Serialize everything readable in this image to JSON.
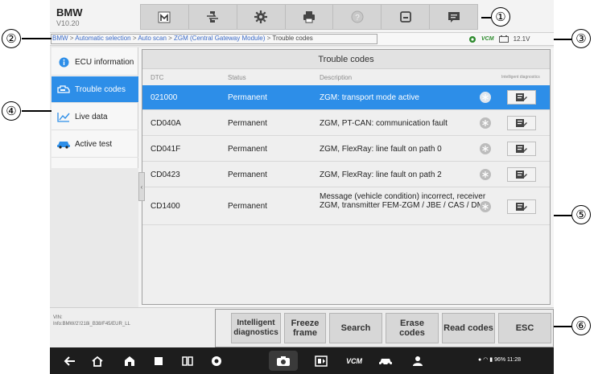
{
  "header": {
    "brand": "BMW",
    "version": "V10.20"
  },
  "toolbar": {
    "icons": [
      "home-icon",
      "vehicle-swap-icon",
      "settings-gear-icon",
      "printer-icon",
      "help-icon",
      "save-icon",
      "message-icon"
    ]
  },
  "breadcrumb": {
    "parts": [
      "BMW",
      "Automatic selection",
      "Auto scan",
      "ZGM (Central Gateway Module)"
    ],
    "current": "Trouble codes",
    "separator": " > "
  },
  "status": {
    "vcm": "VCM",
    "voltage": "12.1V"
  },
  "sidebar": {
    "items": [
      {
        "label": "ECU information",
        "icon": "info-icon"
      },
      {
        "label": "Trouble codes",
        "icon": "engine-fault-icon"
      },
      {
        "label": "Live data",
        "icon": "line-chart-icon"
      },
      {
        "label": "Active test",
        "icon": "car-test-icon"
      }
    ],
    "active_index": 1
  },
  "table": {
    "title": "Trouble codes",
    "headers": {
      "dtc": "DTC",
      "status": "Status",
      "description": "Description",
      "diag": "Intelligent diagnostics"
    },
    "rows": [
      {
        "dtc": "021000",
        "status": "Permanent",
        "description": "ZGM: transport mode active"
      },
      {
        "dtc": "CD040A",
        "status": "Permanent",
        "description": "ZGM, PT-CAN: communication fault"
      },
      {
        "dtc": "CD041F",
        "status": "Permanent",
        "description": "ZGM, FlexRay: line fault on path 0"
      },
      {
        "dtc": "CD0423",
        "status": "Permanent",
        "description": "ZGM, FlexRay: line fault on path 2"
      },
      {
        "dtc": "CD1400",
        "status": "Permanent",
        "description": "Message (vehicle condition) incorrect, receiver ZGM, transmitter FEM-ZGM / JBE / CAS / DME"
      }
    ],
    "selected_index": 0
  },
  "vehicle_info": {
    "vin_label": "VIN:",
    "info": "Info:BMW/2'/218i_B38/F45/EUR_LL"
  },
  "functions": {
    "intelligent": "Intelligent diagnostics",
    "freeze": "Freeze frame",
    "search": "Search",
    "erase": "Erase codes",
    "read": "Read codes",
    "esc": "ESC"
  },
  "navbar": {
    "systray": "96% 11:28"
  },
  "callouts": [
    "①",
    "②",
    "③",
    "④",
    "⑤",
    "⑥"
  ],
  "colors": {
    "accent": "#2d8ee8",
    "link": "#3a6ac8",
    "vcm_green": "#2c8a2c"
  }
}
